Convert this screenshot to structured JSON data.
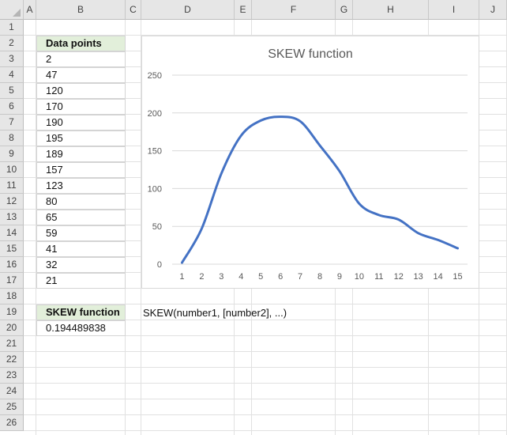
{
  "sheet": {
    "columns": [
      "A",
      "B",
      "C",
      "D",
      "E",
      "F",
      "G",
      "H",
      "I",
      "J"
    ],
    "rows": [
      "1",
      "2",
      "3",
      "4",
      "5",
      "6",
      "7",
      "8",
      "9",
      "10",
      "11",
      "12",
      "13",
      "14",
      "15",
      "16",
      "17",
      "18",
      "19",
      "20",
      "21",
      "22",
      "23",
      "24",
      "25",
      "26"
    ]
  },
  "table": {
    "header": "Data points",
    "values": [
      "2",
      "47",
      "120",
      "170",
      "190",
      "195",
      "189",
      "157",
      "123",
      "80",
      "65",
      "59",
      "41",
      "32",
      "21"
    ]
  },
  "skew": {
    "label": "SKEW function",
    "result": "0.194489838",
    "syntax": "SKEW(number1, [number2], ...)"
  },
  "chart_data": {
    "type": "line",
    "title": "SKEW function",
    "x": [
      1,
      2,
      3,
      4,
      5,
      6,
      7,
      8,
      9,
      10,
      11,
      12,
      13,
      14,
      15
    ],
    "series": [
      {
        "values": [
          2,
          47,
          120,
          170,
          190,
          195,
          189,
          157,
          123,
          80,
          65,
          59,
          41,
          32,
          21
        ],
        "color": "#4472c4"
      }
    ],
    "ylim": [
      0,
      250
    ],
    "yticks": [
      0,
      50,
      100,
      150,
      200,
      250
    ],
    "xticks": [
      "1",
      "2",
      "3",
      "4",
      "5",
      "6",
      "7",
      "8",
      "9",
      "10",
      "11",
      "12",
      "13",
      "14",
      "15"
    ],
    "grid": true,
    "smooth": true
  }
}
